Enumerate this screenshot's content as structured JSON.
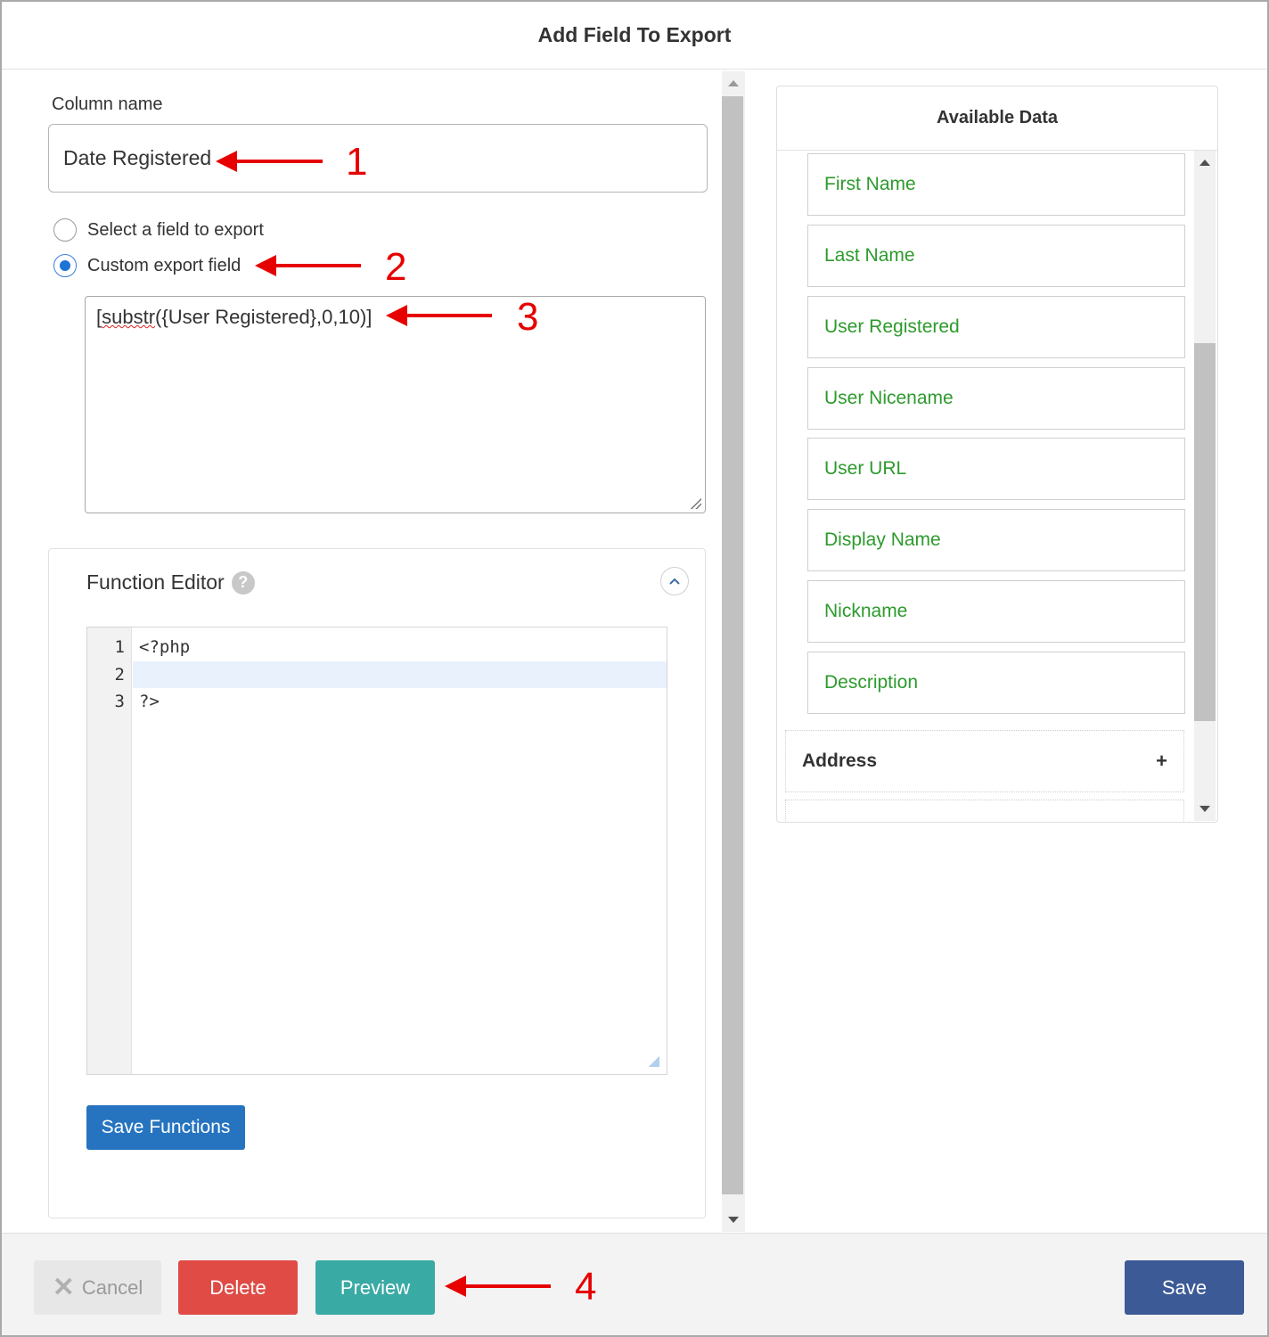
{
  "dialog": {
    "title": "Add Field To Export"
  },
  "left": {
    "column_name_label": "Column name",
    "column_name_value": "Date Registered",
    "radio_select_label": "Select a field to export",
    "radio_custom_label": "Custom export field",
    "custom_field_value_part1": "[",
    "custom_field_value_squiggle": "substr",
    "custom_field_value_part2": "({User Registered},0,10)]"
  },
  "function_editor": {
    "title": "Function Editor",
    "help_icon": "?",
    "collapse_icon": "chevron-up",
    "lines": [
      {
        "num": "1",
        "text": "<?php"
      },
      {
        "num": "2",
        "text": ""
      },
      {
        "num": "3",
        "text": "?>"
      }
    ],
    "save_button": "Save Functions"
  },
  "available_data": {
    "title": "Available Data",
    "items": [
      "First Name",
      "Last Name",
      "User Registered",
      "User Nicename",
      "User URL",
      "Display Name",
      "Nickname",
      "Description"
    ],
    "sections": [
      {
        "label": "Address",
        "icon": "+"
      }
    ],
    "item_color": "#2d9a2d"
  },
  "footer": {
    "cancel": "Cancel",
    "delete": "Delete",
    "preview": "Preview",
    "save": "Save"
  },
  "annotations": [
    "1",
    "2",
    "3",
    "4"
  ],
  "colors": {
    "delete": "#e04b45",
    "preview": "#3aaaa4",
    "save": "#3b5a96",
    "save_functions": "#2674bf",
    "annotation": "#e60000"
  }
}
